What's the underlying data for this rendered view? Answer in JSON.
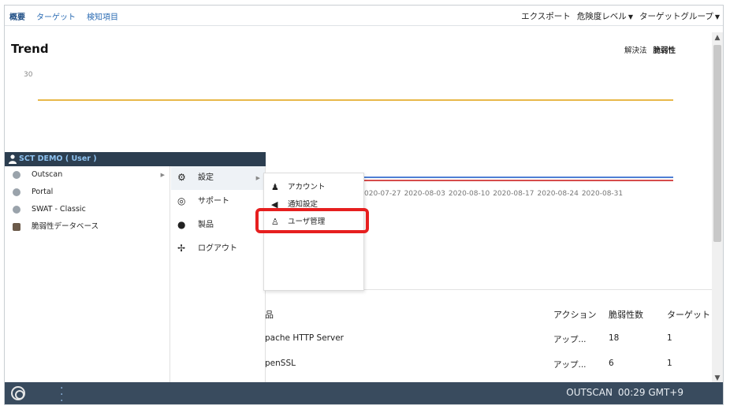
{
  "nav": {
    "left": [
      "概要",
      "ターゲット",
      "検知項目"
    ],
    "right": [
      "エクスポート",
      "危険度レベル",
      "ターゲットグループ"
    ]
  },
  "trend": {
    "title": "Trend",
    "toggle_solutions": "解決法",
    "toggle_vulns": "脆弱性",
    "y_tick": "30",
    "x_dates": [
      "2020-07-27",
      "2020-08-03",
      "2020-08-10",
      "2020-08-17",
      "2020-08-24",
      "2020-08-31"
    ],
    "x_partial_first": "020-07-27",
    "colors": {
      "orange": "#e8b84a",
      "blue": "#4f7fd4",
      "red": "#d64b4b"
    }
  },
  "user_menu": {
    "user_label": "SCT DEMO ( User )",
    "level1": [
      {
        "label": "Outscan",
        "icon": "outscan-icon",
        "has_submenu": true
      },
      {
        "label": "Portal",
        "icon": "portal-icon",
        "has_submenu": false
      },
      {
        "label": "SWAT - Classic",
        "icon": "swat-icon",
        "has_submenu": false
      },
      {
        "label": "脆弱性データベース",
        "icon": "bug-icon",
        "has_submenu": false
      }
    ],
    "level2": [
      {
        "label": "設定",
        "icon": "gear-icon",
        "has_submenu": true
      },
      {
        "label": "サポート",
        "icon": "support-icon",
        "has_submenu": false
      },
      {
        "label": "製品",
        "icon": "chat-icon",
        "has_submenu": false
      },
      {
        "label": "ログアウト",
        "icon": "logout-icon",
        "has_submenu": false
      }
    ],
    "level3": [
      {
        "label": "アカウント",
        "icon": "account-icon"
      },
      {
        "label": "通知設定",
        "icon": "megaphone-icon"
      },
      {
        "label": "ユーザ管理",
        "icon": "users-icon"
      }
    ]
  },
  "table": {
    "headers": {
      "name": "製品",
      "action": "アクション",
      "vulns": "脆弱性数",
      "targets": "ターゲット"
    },
    "header_name_visible": "品",
    "rows": [
      {
        "name": "pache HTTP Server",
        "action": "アップ...",
        "vulns": "18",
        "targets": "1"
      },
      {
        "name": "penSSL",
        "action": "アップ...",
        "vulns": "6",
        "targets": "1"
      }
    ]
  },
  "status": {
    "product": "OUTSCAN",
    "time": "00:29 GMT+9"
  }
}
